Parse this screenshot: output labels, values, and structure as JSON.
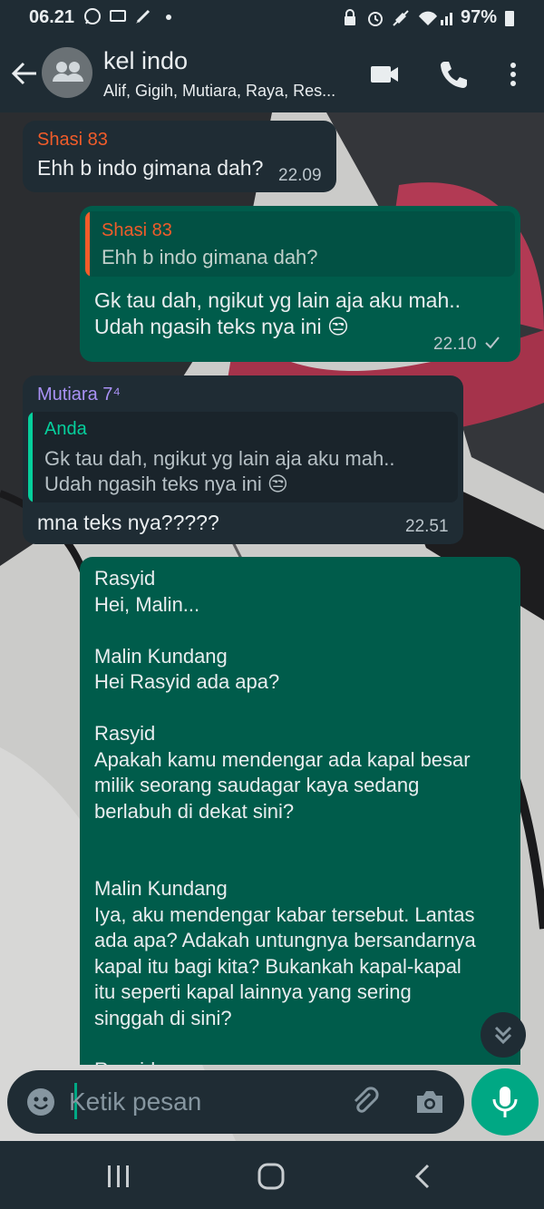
{
  "status_bar": {
    "time": "06.21",
    "battery": "97%"
  },
  "header": {
    "title": "kel indo",
    "subtitle": "Alif, Gigih, Mutiara, Raya, Res..."
  },
  "messages": [
    {
      "direction": "incoming",
      "sender": "Shasi 83",
      "sender_color": "#f15c2a",
      "text": "Ehh b indo gimana dah?",
      "time": "22.09"
    },
    {
      "direction": "outgoing",
      "quote": {
        "author": "Shasi 83",
        "author_color": "#f15c2a",
        "text": "Ehh b indo gimana dah?"
      },
      "text": "Gk tau dah, ngikut yg lain aja aku mah..\nUdah ngasih teks nya ini 😒",
      "time": "22.10"
    },
    {
      "direction": "incoming",
      "sender": "Mutiara 7⁴",
      "sender_color": "#a991f5",
      "quote": {
        "author": "Anda",
        "author_color": "#06cf9c",
        "text": "Gk tau dah, ngikut yg lain aja aku mah..\nUdah ngasih teks nya ini 😒"
      },
      "text": "mna teks nya?????",
      "time": "22.51"
    },
    {
      "direction": "outgoing",
      "text": "Rasyid\nHei, Malin...\n\nMalin Kundang\nHei Rasyid ada apa?\n\nRasyid\nApakah kamu mendengar ada kapal besar\nmilik seorang saudagar kaya sedang\nberlabuh di dekat sini?\n\n\nMalin Kundang\nIya, aku mendengar kabar tersebut. Lantas\nada apa? Adakah untungnya bersandarnya\nkapal itu bagi kita? Bukankah kapal-kapal\nitu seperti kapal lainnya yang sering\nsinggah di sini?\n\nRasyid"
    }
  ],
  "input": {
    "placeholder": "Ketik pesan"
  },
  "icons": {
    "back": "arrow-left-icon",
    "video": "video-camera-icon",
    "call": "phone-icon",
    "menu": "more-vertical-icon",
    "emoji": "emoji-icon",
    "attach": "paperclip-icon",
    "camera": "camera-icon",
    "mic": "mic-icon",
    "scroll": "double-chevron-down-icon"
  },
  "colors": {
    "header_bg": "#1f2c34",
    "incoming_bubble": "#1f2c34",
    "outgoing_bubble": "#005c4b",
    "accent": "#00a884"
  }
}
